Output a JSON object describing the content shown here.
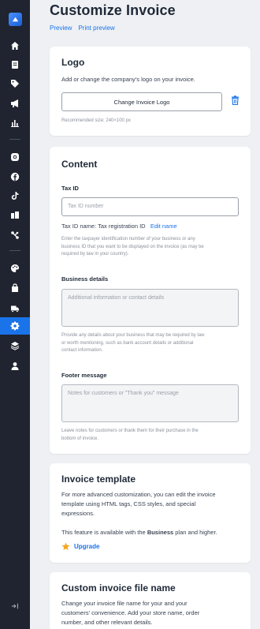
{
  "page": {
    "title": "Customize Invoice",
    "links": [
      "Preview",
      "Print preview"
    ]
  },
  "sidebar": {
    "items": [
      {
        "icon": "home-icon"
      },
      {
        "icon": "orders-icon"
      },
      {
        "icon": "tag-icon"
      },
      {
        "icon": "megaphone-icon"
      },
      {
        "icon": "chart-icon"
      },
      {
        "icon": "instagram-icon"
      },
      {
        "icon": "facebook-icon"
      },
      {
        "icon": "tiktok-icon"
      },
      {
        "icon": "catalog-icon"
      },
      {
        "icon": "integrations-icon"
      },
      {
        "icon": "palette-icon"
      },
      {
        "icon": "store-icon"
      },
      {
        "icon": "truck-icon"
      },
      {
        "icon": "gear-icon",
        "active": true
      },
      {
        "icon": "layers-icon"
      },
      {
        "icon": "user-icon"
      }
    ]
  },
  "logo": {
    "title": "Logo",
    "description": "Add or change the company's logo on your invoice.",
    "button": "Change Invoice Logo",
    "hint": "Recommended size: 240×100 px"
  },
  "content": {
    "title": "Content",
    "tax_id": {
      "label": "Tax ID",
      "placeholder": "Tax ID number",
      "name_label": "Tax ID name: Tax registration ID",
      "edit_link": "Edit name",
      "hint_lines": [
        "Enter the taxpayer identification number of your business or any",
        "business ID that you want to be displayed on the invoice (as may be",
        "required by law in your country)."
      ]
    },
    "business": {
      "label": "Business details",
      "placeholder": "Additional information or contact details",
      "hint_lines": [
        "Provide any details about your business that may be required by law",
        "or worth mentioning, such as bank account details or additional",
        "contact information."
      ]
    },
    "footer": {
      "label": "Footer message",
      "placeholder": "Notes for customers or \"Thank you\" message",
      "hint_lines": [
        "Leave notes for customers or thank them for their purchase in the",
        "bottom of invoice."
      ]
    }
  },
  "template": {
    "title": "Invoice template",
    "description_lines": [
      "For more advanced customization, you can edit the invoice",
      "template using HTML tags, CSS styles, and special",
      "expressions."
    ],
    "plan_note_before": "This feature is available with the ",
    "plan_note_bold": "Business",
    "plan_note_after": " plan and higher.",
    "upgrade": "Upgrade"
  },
  "filename": {
    "title": "Custom invoice file name",
    "description_lines": [
      "Change your invoice file name for your and your",
      "customers' convenience. Add your store name, order",
      "number, and other relevant details."
    ]
  },
  "colors": {
    "sidebar_bg": "#1f2430",
    "accent": "#1a73e8",
    "page_bg": "#eef0f3",
    "star": "#f5a623"
  }
}
